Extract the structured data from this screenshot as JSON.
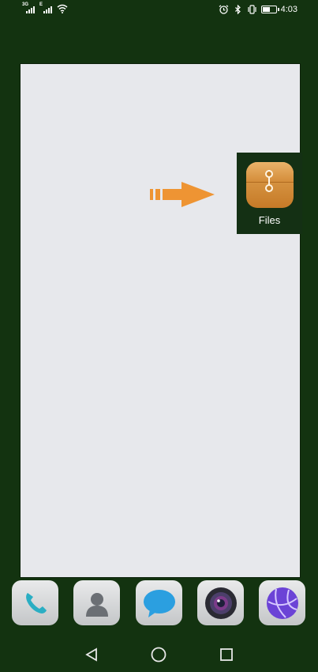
{
  "status_bar": {
    "network_left": "3G",
    "network_right": "E",
    "time": "4:03",
    "icons": [
      "alarm-icon",
      "bluetooth-icon",
      "vibrate-icon",
      "battery-icon"
    ],
    "battery_level": 0.6
  },
  "hint": {
    "arrow_color": "#ee9433"
  },
  "files_tile": {
    "label": "Files",
    "icon": "folder-envelope-icon"
  },
  "dock": {
    "apps": [
      {
        "name": "phone",
        "icon": "phone-icon"
      },
      {
        "name": "contacts",
        "icon": "contacts-icon"
      },
      {
        "name": "messages",
        "icon": "message-icon"
      },
      {
        "name": "camera",
        "icon": "camera-icon"
      },
      {
        "name": "browser",
        "icon": "browser-icon"
      }
    ]
  },
  "nav": {
    "buttons": [
      "back-icon",
      "home-icon",
      "recents-icon"
    ]
  },
  "colors": {
    "background": "#133310",
    "panel": "#e7e8ec",
    "accent": "#ee9433"
  }
}
